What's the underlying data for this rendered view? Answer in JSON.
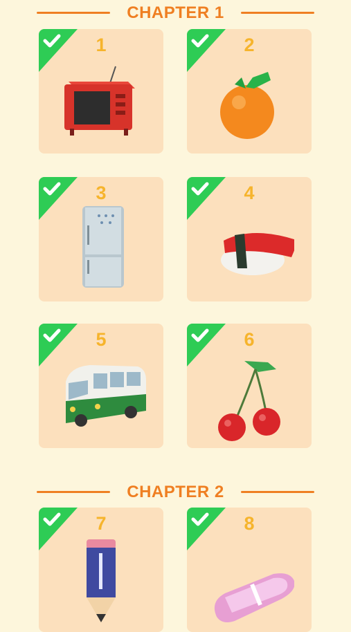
{
  "chapters": [
    {
      "title": "CHAPTER 1",
      "levels": [
        {
          "number": "1",
          "item_icon": "tv-icon",
          "completed": true
        },
        {
          "number": "2",
          "item_icon": "orange-icon",
          "completed": true
        },
        {
          "number": "3",
          "item_icon": "refrigerator-icon",
          "completed": true
        },
        {
          "number": "4",
          "item_icon": "sushi-icon",
          "completed": true
        },
        {
          "number": "5",
          "item_icon": "bus-icon",
          "completed": true
        },
        {
          "number": "6",
          "item_icon": "cherries-icon",
          "completed": true
        }
      ]
    },
    {
      "title": "CHAPTER 2",
      "levels": [
        {
          "number": "7",
          "item_icon": "pencil-icon",
          "completed": true
        },
        {
          "number": "8",
          "item_icon": "eraser-icon",
          "completed": true
        }
      ]
    }
  ],
  "colors": {
    "background": "#fdf6dc",
    "card": "#fce0bd",
    "accent": "#ef7f22",
    "level_number": "#f6b42c",
    "check_badge": "#2ecc55"
  }
}
